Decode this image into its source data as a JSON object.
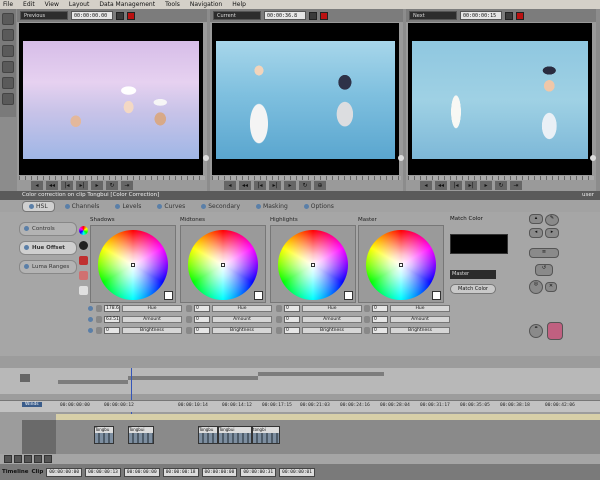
{
  "menu": [
    "File",
    "Edit",
    "View",
    "Layout",
    "Data Management",
    "Tools",
    "Navigation",
    "Help"
  ],
  "monitors": [
    {
      "source": "Previous",
      "timecode": "00:00:00.00",
      "image": "flower-girl-and-boys-pastel-sky"
    },
    {
      "source": "Current",
      "timecode": "00:00:36.8",
      "image": "flower-girl-and-boy-blue-sea"
    },
    {
      "source": "Next",
      "timecode": "00:00:00:15",
      "image": "girl-in-white-and-boy-blue-sea"
    }
  ],
  "color_correction": {
    "header": "Color correction on clip Tongbui [Color Correction]",
    "user": "user",
    "tabs": [
      "HSL",
      "Channels",
      "Levels",
      "Curves",
      "Secondary",
      "Masking",
      "Options"
    ],
    "active_tab": "HSL",
    "side_items": [
      "Controls",
      "Hue Offset",
      "Luma Ranges"
    ],
    "active_side": "Hue Offset",
    "wheels": [
      {
        "label": "Shadows",
        "hue": "178.6",
        "amount": "63.51",
        "brightness": "0"
      },
      {
        "label": "Midtones",
        "hue": "0",
        "amount": "0",
        "brightness": "0"
      },
      {
        "label": "Highlights",
        "hue": "0",
        "amount": "0",
        "brightness": "0"
      },
      {
        "label": "Master",
        "hue": "0",
        "amount": "0",
        "brightness": "0"
      }
    ],
    "field_names": {
      "hue": "Hue",
      "amount": "Amount",
      "brightness": "Brightness"
    },
    "match_color": {
      "label": "Match Color",
      "select": "Master",
      "button": "Match Color"
    },
    "swatch_colors": [
      "#f04090",
      "#202020",
      "#c03030",
      "#d07070",
      "#e0e0e0"
    ]
  },
  "timeline": {
    "sequence_name": "Winds",
    "ruler": [
      "00:00:00:00",
      "00:00:00:12",
      "00:00:10:14",
      "00:00:14:12",
      "00:00:17:15",
      "00:00:21:03",
      "00:00:24:16",
      "00:00:28:04",
      "00:00:31:17",
      "00:00:35:05",
      "00:00:38:18",
      "00:00:42:06"
    ],
    "clips": [
      "Tongbu",
      "Tongbui",
      "Tongbu",
      "Tongbui",
      "tongbi"
    ],
    "footer_left": "Timeline",
    "footer_clip": "Clip",
    "footer_timecodes": [
      "00:00:00:00",
      "00:00:00:13",
      "00:00:00:00",
      "00:00:00:18",
      "00:00:00:00",
      "00:00:00:31",
      "00:00:00:01"
    ]
  }
}
